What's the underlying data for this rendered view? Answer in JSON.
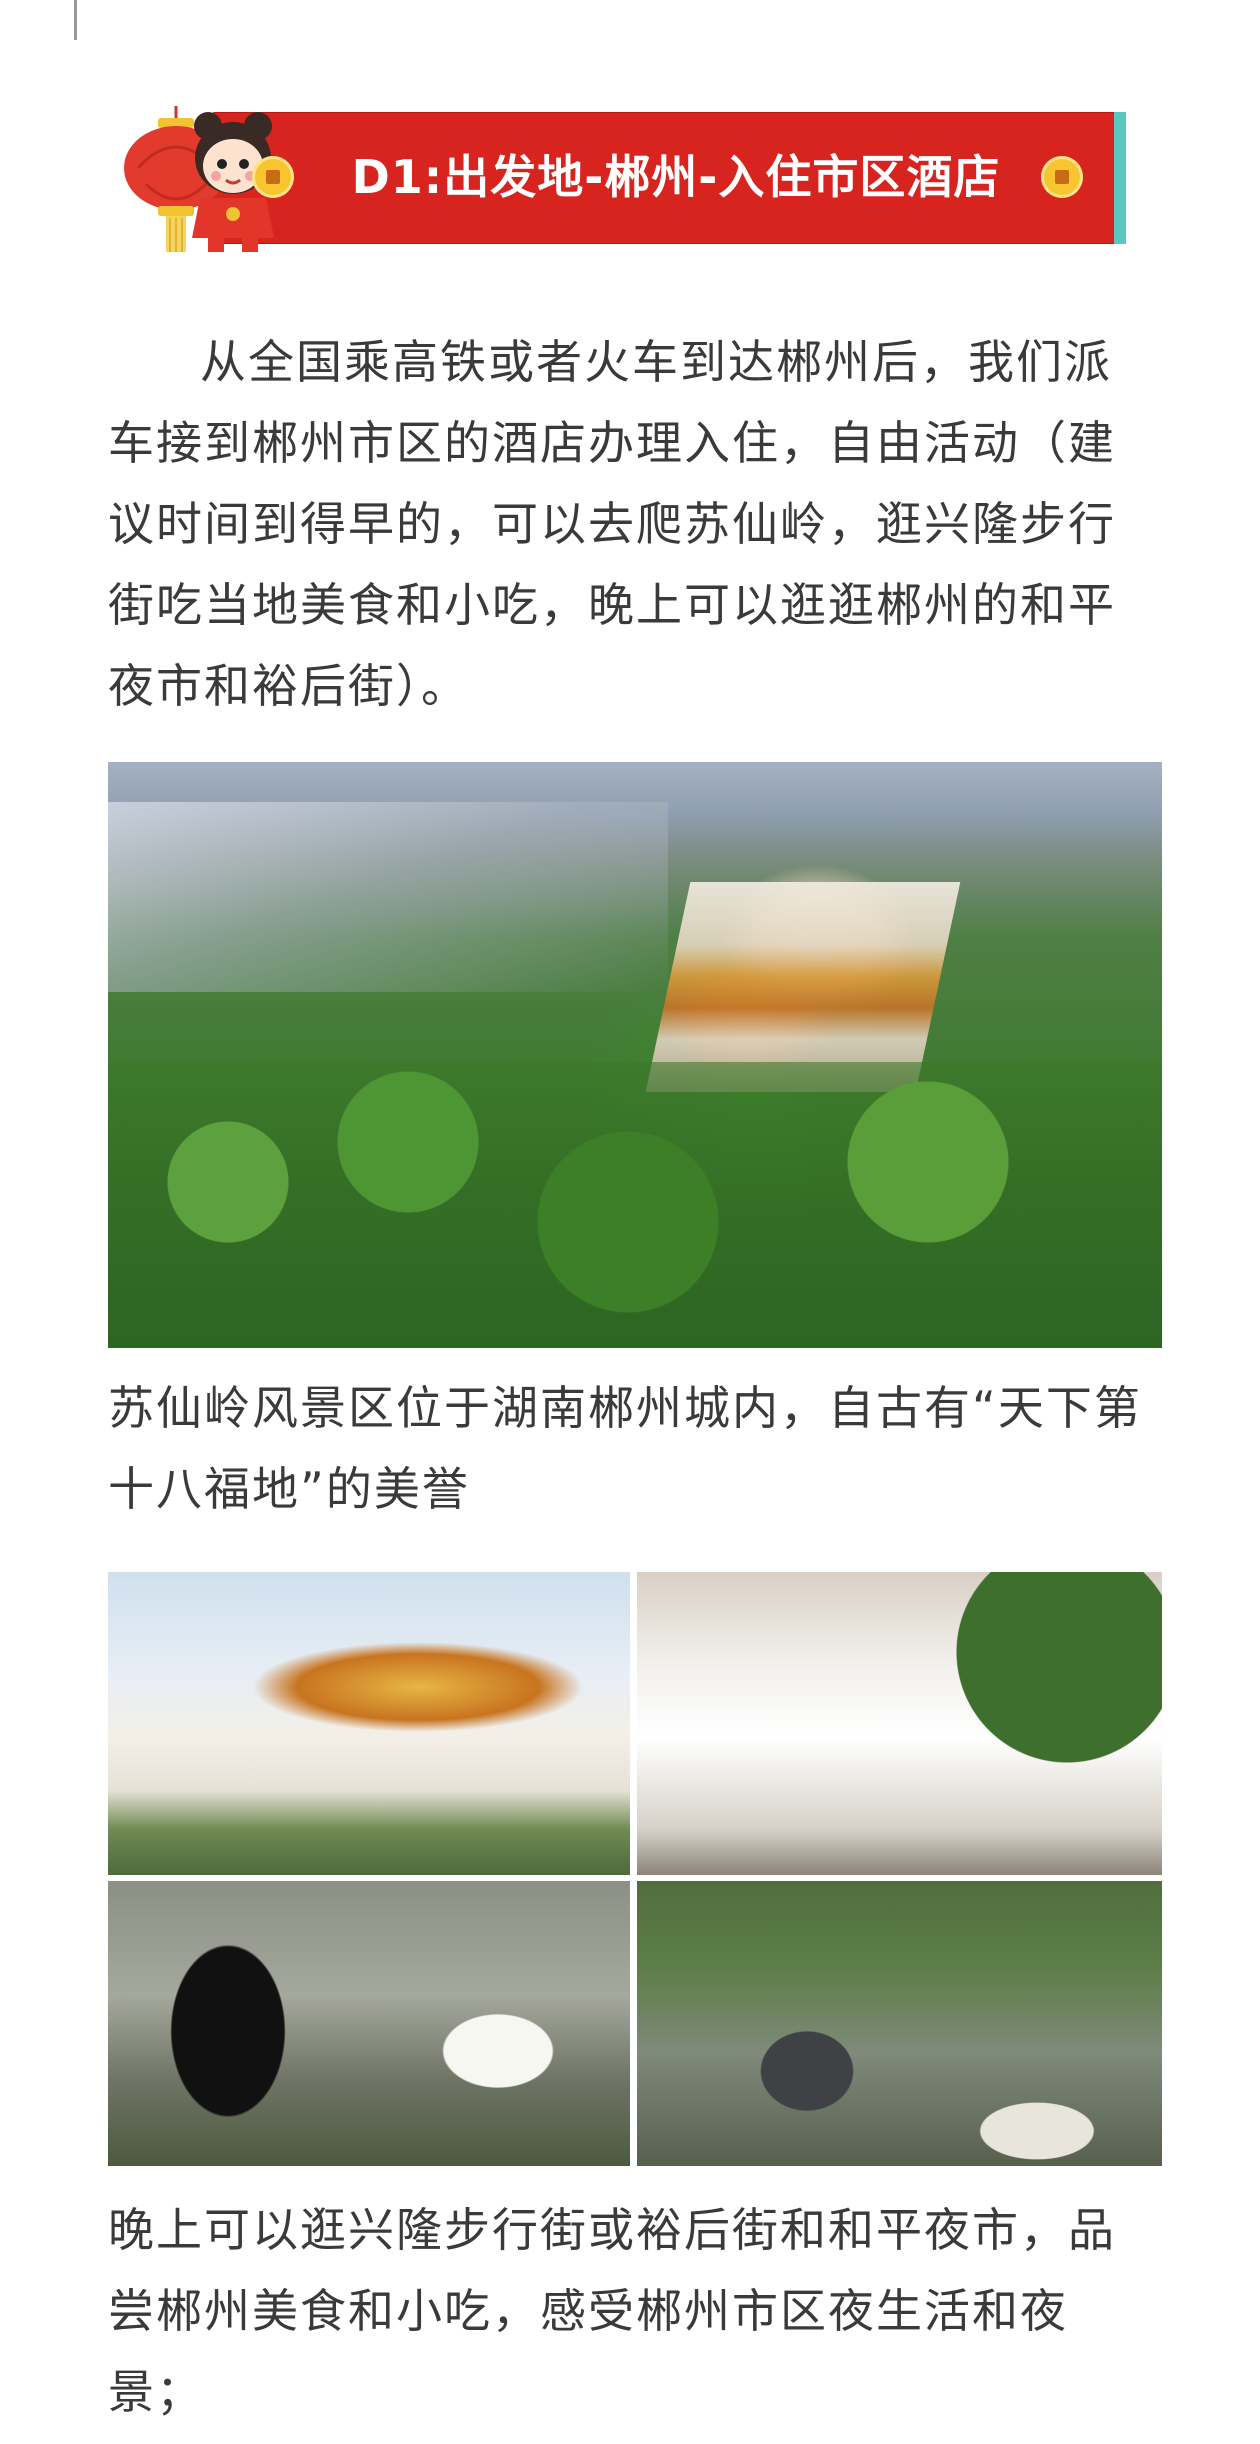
{
  "banner": {
    "title": "D1:出发地-郴州-入住市区酒店",
    "colors": {
      "bar": "#d7241f",
      "accent_tab": "#5cc6c0",
      "coin": "#f8c531"
    },
    "icons": [
      "lantern-icon",
      "mascot-icon",
      "coin-icon"
    ]
  },
  "intro": {
    "text": "从全国乘高铁或者火车到达郴州后，我们派车接到郴州市区的酒店办理入住，自由活动（建议时间到得早的，可以去爬苏仙岭，逛兴隆步行街吃当地美食和小吃，晚上可以逛逛郴州的和平夜市和裕后街）。"
  },
  "photos": {
    "main": "photo-mountain-temple",
    "grid": [
      "photo-temple-gate",
      "photo-archway",
      "photo-cave-deer",
      "photo-statue"
    ]
  },
  "caption_1": {
    "text": "苏仙岭风景区位于湖南郴州城内，自古有“天下第十八福地”的美誉"
  },
  "caption_2": {
    "text": "晚上可以逛兴隆步行街或裕后街和和平夜市，品尝郴州美食和小吃，感受郴州市区夜生活和夜景；"
  }
}
